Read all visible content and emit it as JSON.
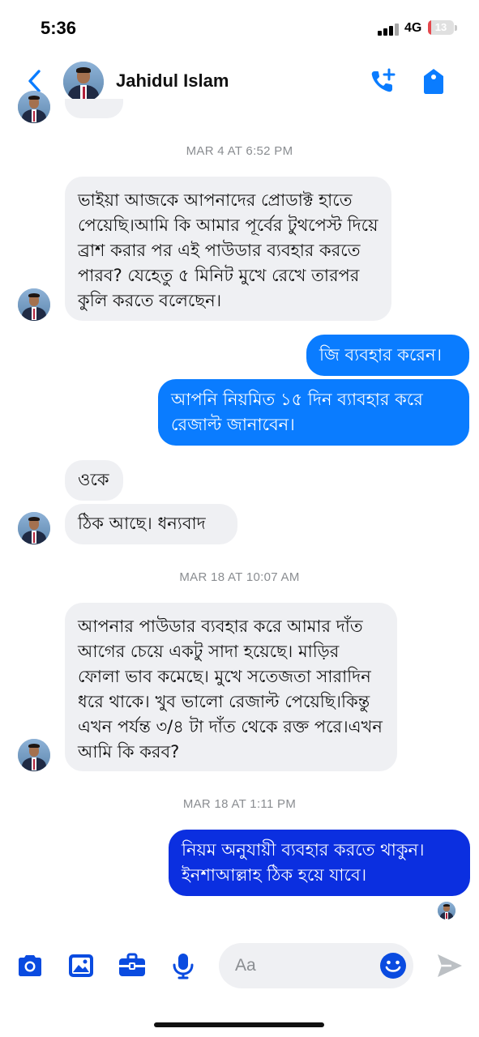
{
  "status_bar": {
    "time": "5:36",
    "network": "4G",
    "battery": "13",
    "battery_level": 0.13
  },
  "header": {
    "contact_name": "Jahidul Islam"
  },
  "thread": {
    "timestamps": [
      "MAR 4 AT 6:52 PM",
      "MAR 18 AT 10:07 AM",
      "MAR 18 AT 1:11 PM"
    ],
    "messages": [
      {
        "side": "in",
        "text": "ভাইয়া আজকে আপনাদের প্রোডাক্ট হাতে পেয়েছি।আমি কি আমার পূর্বের টুথপেস্ট দিয়ে ব্রাশ করার পর এই পাউডার ব্যবহার করতে পারব? যেহেতু ৫ মিনিট মুখে রেখে তারপর কুলি করতে বলেছেন।"
      },
      {
        "side": "out",
        "text": "জি ব্যবহার করেন।"
      },
      {
        "side": "out",
        "text": "আপনি নিয়মিত ১৫ দিন ব্যাবহার করে রেজাল্ট জানাবেন।"
      },
      {
        "side": "in",
        "text": "ওকে"
      },
      {
        "side": "in",
        "text": "ঠিক আছে। ধন্যবাদ"
      },
      {
        "side": "in",
        "text": "আপনার পাউডার ব্যবহার করে আমার দাঁত আগের চেয়ে একটু সাদা হয়েছে। মাড়ির ফোলা ভাব কমেছে। মুখে সতেজতা সারাদিন ধরে থাকে। খুব ভালো রেজাল্ট পেয়েছি।কিন্তু এখন পর্যন্ত ৩/৪ টা দাঁত থেকে রক্ত পরে।এখন আমি কি করব?"
      },
      {
        "side": "out",
        "text": "নিয়ম অনুযায়ী ব্যবহার করতে থাকুন। ইনশাআল্লাহ ঠিক হয়ে যাবে।"
      }
    ]
  },
  "composer": {
    "placeholder": "Aa"
  },
  "colors": {
    "accent": "#0a7cff",
    "accent_dark": "#0b2fe0",
    "incoming": "#eff0f3"
  }
}
